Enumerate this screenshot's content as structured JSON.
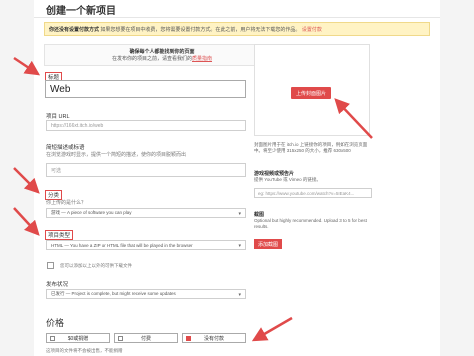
{
  "header": {
    "title": "创建一个新项目"
  },
  "notice": {
    "bold": "你还没有设置付款方式",
    "text": "如果您想要在项目中收费，您将需要设置付款方式。在此之前，用户将无法下载您的作品。",
    "link": "设置付款"
  },
  "info": {
    "line1": "确保每个人都能找到你的页面",
    "line2": "在发布你的项目之前，请查看我们的",
    "link": "质量指南"
  },
  "form": {
    "title_label": "标题",
    "title_value": "Web",
    "url_label": "项目 URL",
    "url_value": "https://166xt.itch.io/web",
    "short_label": "简短描述或标语",
    "short_sub": "在浏览游戏时显示，提供一个简短的描述，使你的项目脱颖而出",
    "short_placeholder": "可选",
    "class_label": "分类",
    "class_sub": "你上传的是什么？",
    "class_value": "游戏 — A piece of software you can play",
    "kind_label": "项目类型",
    "kind_value": "HTML — You have a ZIP or HTML file that will be played in the browser",
    "kind_check": "您可以添加以上以外的可供下载文件",
    "release_label": "发布状况",
    "release_value": "已发行 — Project is complete, but might receive some updates"
  },
  "right": {
    "cover_button": "上传封面图片",
    "cover_text": "封面图片用于在 itch.io 上链接你的项目，例如在浏览页面中。将至少使用 315x250 的大小，推荐 630x500",
    "video_label": "游戏视频或预告片",
    "video_sub": "提供 YouTube 或 Vimeo 的链接。",
    "video_placeholder": "eg: https://www.youtube.com/watch?v=5IEaK4...",
    "shots_label": "截图",
    "shots_text": "Optional but highly recommended. Upload 3 to 5 for best results.",
    "add_button": "添加截图"
  },
  "pricing": {
    "title": "价格",
    "options": [
      "$0或捐赠",
      "付费",
      "没有付款"
    ],
    "selected_index": 2,
    "note": "这项目的文件将不会被出售，不能捐赠"
  },
  "colors": {
    "accent": "#e04a4a",
    "notice_bg": "#fff3c4"
  }
}
